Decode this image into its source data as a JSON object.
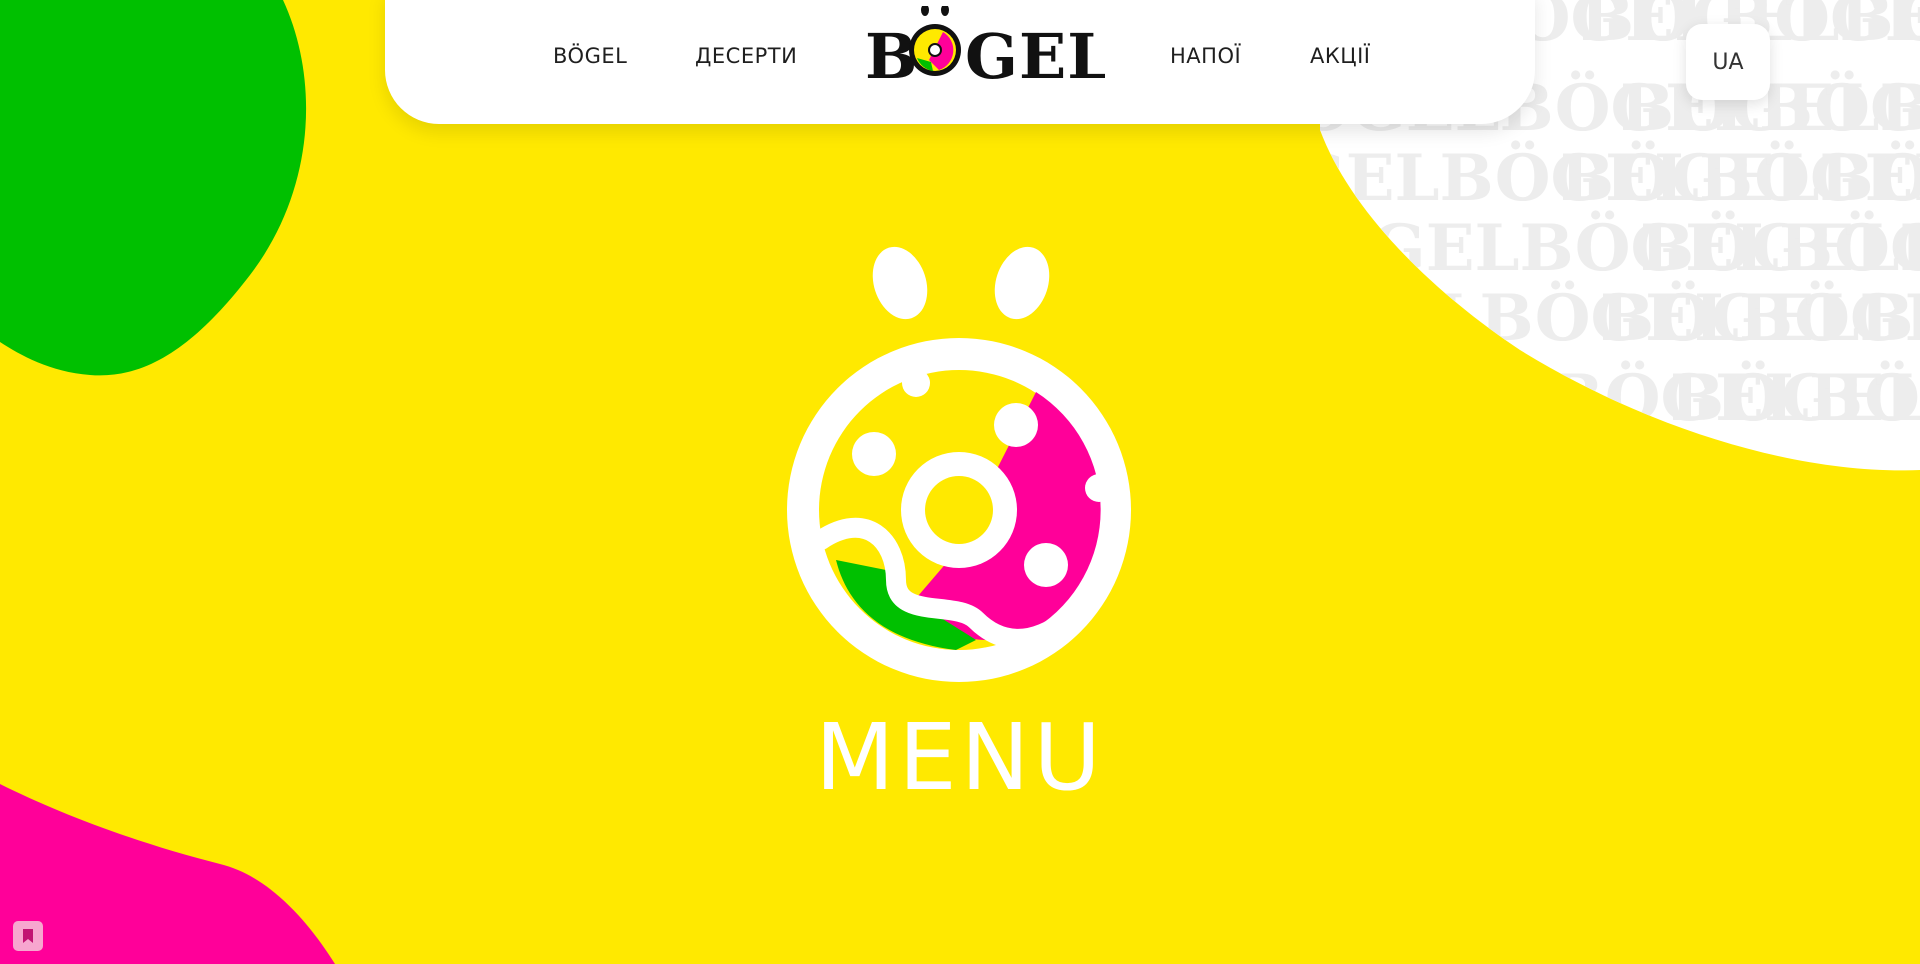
{
  "colors": {
    "background": "#FFE900",
    "green": "#00C000",
    "pink": "#FF0099",
    "white": "#FFFFFF",
    "text": "#1F1F1F"
  },
  "header": {
    "nav_left": [
      {
        "label": "BÖGEL"
      },
      {
        "label": "ДЕСЕРТИ"
      }
    ],
    "logo_text": "BÖGEL",
    "nav_right": [
      {
        "label": "НАПОЇ"
      },
      {
        "label": "АКЦІЇ"
      }
    ]
  },
  "language_button": {
    "label": "UA"
  },
  "hero": {
    "title": "MENU"
  },
  "background_pattern_text": "BÖGEL",
  "icons": {
    "hero": "donut-logo-icon",
    "bookmark": "bookmark-icon"
  }
}
